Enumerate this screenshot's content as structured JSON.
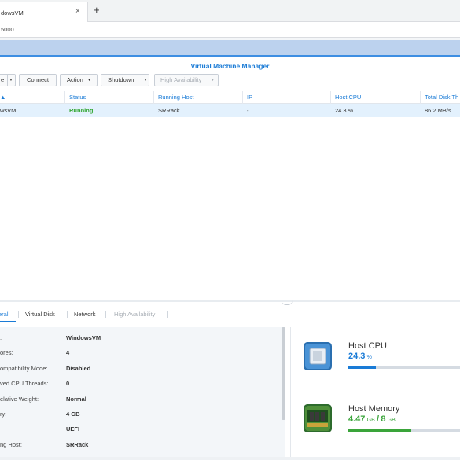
{
  "browser": {
    "tab_title": "dowsVM",
    "tab_close": "×",
    "new_tab": "+",
    "address": "5000"
  },
  "window": {
    "title": "Virtual Machine Manager"
  },
  "toolbar": {
    "buttons": [
      {
        "label": "e",
        "has_dropdown": true
      },
      {
        "label": "Connect",
        "has_dropdown": false
      },
      {
        "label": "Action",
        "has_dropdown": true
      },
      {
        "label": "Shutdown",
        "has_dropdown": true
      },
      {
        "label": "High Availability",
        "has_dropdown": true,
        "disabled": true
      }
    ],
    "dropdown_glyph": "▼"
  },
  "grid": {
    "columns": [
      "▲",
      "Status",
      "Running Host",
      "IP",
      "Host CPU",
      "Total Disk Th"
    ],
    "rows": [
      {
        "name": "wsVM",
        "status": "Running",
        "host": "SRRack",
        "ip": "-",
        "cpu": "24.3 %",
        "disk": "86.2 MB/s"
      }
    ]
  },
  "detail_tabs": [
    "eral",
    "Virtual Disk",
    "Network",
    "High Availability"
  ],
  "properties": [
    {
      "label": ":",
      "value": "WindowsVM"
    },
    {
      "label": "ores:",
      "value": "4"
    },
    {
      "label": "ompatibility Mode:",
      "value": "Disabled"
    },
    {
      "label": "ved CPU Threads:",
      "value": "0"
    },
    {
      "label": "elative Weight:",
      "value": "Normal"
    },
    {
      "label": "ry:",
      "value": "4 GB"
    },
    {
      "label": "",
      "value": "UEFI"
    },
    {
      "label": "ng Host:",
      "value": "SRRack"
    }
  ],
  "status": {
    "cpu": {
      "title": "Host CPU",
      "value": "24.3",
      "unit": "%",
      "fraction": 0.243
    },
    "memory": {
      "title": "Host Memory",
      "used": "4.47",
      "used_unit": "GB",
      "sep": "/",
      "total": "8",
      "total_unit": "GB",
      "fraction": 0.56
    }
  },
  "colors": {
    "accent": "#1a7bd6",
    "running": "#2fa52f",
    "memory_green": "#3aa43a",
    "header_strip": "#bcd2ee"
  },
  "icons": {
    "cpu": "cpu-chip-icon",
    "memory": "memory-module-icon"
  }
}
